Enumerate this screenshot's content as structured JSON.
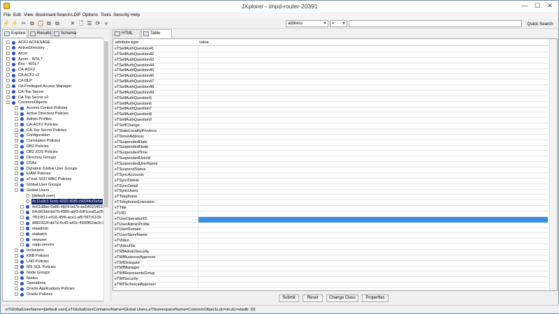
{
  "window": {
    "title": "JXplorer - impd-router-20391",
    "minimize": "—",
    "maximize": "☐",
    "close": "✕"
  },
  "menu": [
    "File",
    "Edit",
    "View",
    "Bookmark",
    "Search",
    "LDIF",
    "Options",
    "Tools",
    "Security",
    "Help"
  ],
  "toolbar": {
    "icons": [
      "connect-icon",
      "disconnect-icon",
      "cut-icon",
      "copy-icon",
      "paste-icon",
      "copy-dn-icon",
      "paste-alias-icon",
      "delete-icon",
      "new-entry-icon",
      "rename-icon",
      "refresh-icon",
      "stop-icon"
    ],
    "glyphs": [
      "⚡",
      "⚡",
      "✂",
      "⧉",
      "📋",
      "⧉",
      "⧉",
      "✕",
      "🗋",
      "☰",
      "⟳",
      "●"
    ],
    "attr_select": "address",
    "op_select": "=",
    "search_value": "",
    "quick_search": "Quick Search"
  },
  "left_tabs": [
    "Explore",
    "Results",
    "Schema"
  ],
  "tree": [
    {
      "label": "ACF2 ACFESAGE",
      "level": 0,
      "exp": "+"
    },
    {
      "label": "ActiveDirectory",
      "level": 0,
      "exp": "+"
    },
    {
      "label": "Arcot",
      "level": 0,
      "exp": "+"
    },
    {
      "label": "Azure - WSL7",
      "level": 0,
      "exp": "+"
    },
    {
      "label": "Box - WSL7",
      "level": 0,
      "exp": "+"
    },
    {
      "label": "CA-ACF2",
      "level": 0,
      "exp": "+"
    },
    {
      "label": "CA ACF2 v2",
      "level": 0,
      "exp": "+"
    },
    {
      "label": "CA DLP",
      "level": 0,
      "exp": "+"
    },
    {
      "label": "CA Privileged Access Manager",
      "level": 0,
      "exp": "+"
    },
    {
      "label": "CA-Top Secret",
      "level": 0,
      "exp": "+"
    },
    {
      "label": "CA Top Secret v2",
      "level": 0,
      "exp": "+"
    },
    {
      "label": "CommonObjects",
      "level": 0,
      "exp": "−"
    },
    {
      "label": "Access Control Policies",
      "level": 1,
      "exp": "+"
    },
    {
      "label": "Active Directory Policies",
      "level": 1,
      "exp": "+"
    },
    {
      "label": "Admin Profiles",
      "level": 1,
      "exp": "+"
    },
    {
      "label": "CA-ACF2 Policies",
      "level": 1,
      "exp": "+"
    },
    {
      "label": "CA-Top Secret Policies",
      "level": 1,
      "exp": "+"
    },
    {
      "label": "Configuration",
      "level": 1,
      "exp": "+"
    },
    {
      "label": "Correlation Policies",
      "level": 1,
      "exp": "+"
    },
    {
      "label": "DB2 Policies",
      "level": 1,
      "exp": "+"
    },
    {
      "label": "DB2 ZOS Policies",
      "level": 1,
      "exp": "+"
    },
    {
      "label": "Directory Groups",
      "level": 1,
      "exp": "+"
    },
    {
      "label": "DSAs",
      "level": 1,
      "exp": "+"
    },
    {
      "label": "Dynamic Global User Groups",
      "level": 1,
      "exp": "+"
    },
    {
      "label": "EIAM Policies",
      "level": 1,
      "exp": "+"
    },
    {
      "label": "eTrust SSO WAC Policies",
      "level": 1,
      "exp": "+"
    },
    {
      "label": "Global User Groups",
      "level": 1,
      "exp": "+"
    },
    {
      "label": "Global Users",
      "level": 1,
      "exp": "−"
    },
    {
      "label": "[default user]",
      "level": 2,
      "exp": "",
      "hollow": true
    },
    {
      "label": "4c11a9c1-6cdc-4202-81f5-c902f4cf2e5d",
      "level": 2,
      "exp": "",
      "selected": true,
      "hollow": true
    },
    {
      "label": "4c61d8be-0a86-4b64-bd7b-ae5491546310",
      "level": 2,
      "exp": "+"
    },
    {
      "label": "64c663dd-bd78-4080-abf3-59f1ceaf1a05",
      "level": 2,
      "exp": "+"
    },
    {
      "label": "7f610f12-e016-45f6-ace1-af576f7c6109",
      "level": 2,
      "exp": "+"
    },
    {
      "label": "d882322f-dd7d-4c40-a42c-4900f62ae3c7",
      "level": 2,
      "exp": "+"
    },
    {
      "label": "etaadmin",
      "level": 2,
      "exp": "+"
    },
    {
      "label": "etabatch",
      "level": 2,
      "exp": "+"
    },
    {
      "label": "newuser",
      "level": 2,
      "exp": "+"
    },
    {
      "label": "vapp-service",
      "level": 2,
      "exp": "+"
    },
    {
      "label": "Inclusions",
      "level": 1,
      "exp": "+"
    },
    {
      "label": "KRB Policies",
      "level": 1,
      "exp": "+"
    },
    {
      "label": "LND Policies",
      "level": 1,
      "exp": "+"
    },
    {
      "label": "MS SQL Policies",
      "level": 1,
      "exp": "+"
    },
    {
      "label": "Node Groups",
      "level": 1,
      "exp": "+"
    },
    {
      "label": "Nodes",
      "level": 1,
      "exp": "+"
    },
    {
      "label": "Operations",
      "level": 1,
      "exp": "+"
    },
    {
      "label": "Oracle Applications Policies",
      "level": 1,
      "exp": "+"
    },
    {
      "label": "Oracle Policies",
      "level": 1,
      "exp": "+"
    }
  ],
  "right_tabs": [
    "HTML View",
    "Table Editor"
  ],
  "table": {
    "headers": [
      "attribute type",
      "value"
    ],
    "rows": [
      "eTSelfAuthQuestion41",
      "eTSelfAuthQuestion42",
      "eTSelfAuthQuestion43",
      "eTSelfAuthQuestion44",
      "eTSelfAuthQuestion45",
      "eTSelfAuthQuestion46",
      "eTSelfAuthQuestion47",
      "eTSelfAuthQuestion48",
      "eTSelfAuthQuestion49",
      "eTSelfAuthQuestion5",
      "eTSelfAuthQuestion6",
      "eTSelfAuthQuestion7",
      "eTSelfAuthQuestion8",
      "eTSelfAuthQuestion9",
      "eTSelfChange",
      "eTStateLocalityProvince",
      "eTStreetAddress",
      "eTSuspendedDate",
      "eTSuspendedNode",
      "eTSuspendedTime",
      "eTSuspendedUserid",
      "eTSuspendedUserName",
      "eTSuspendStatus",
      "eTSyncAccounts",
      "eTSyncDelete",
      "eTSyncDetail",
      "eTSyncUsers",
      "eTTelephone",
      "eTTelephoneExtension",
      "eTTitle",
      "eTUID",
      "eTUseOperationID",
      "eTUserAdminProfile",
      "eTUserDomain",
      "eTUserStoreName",
      "eTVideo",
      "eTVideoFile",
      "eTWfAdminSecurity",
      "eTWfBusinessApprover",
      "eTWfDelegate",
      "eTWfManager",
      "eTWfRepresentsGroup",
      "eTWfSecurity",
      "eTWfTechnicalApprover"
    ],
    "highlighted_row": "eTUseOperationID"
  },
  "buttons": [
    "Submit",
    "Reset",
    "Change Class",
    "Properties"
  ],
  "status": "eTGlobalUserName=[default user],eTGlobalUserContainerName=Global Users,eTNamespaceName=CommonObjects,dc=im,dc=etadb: (0)",
  "colors": {
    "selection": "#0a246a",
    "row_highlight": "#3b8fe0",
    "tree_dot": "#1e4bd2"
  }
}
